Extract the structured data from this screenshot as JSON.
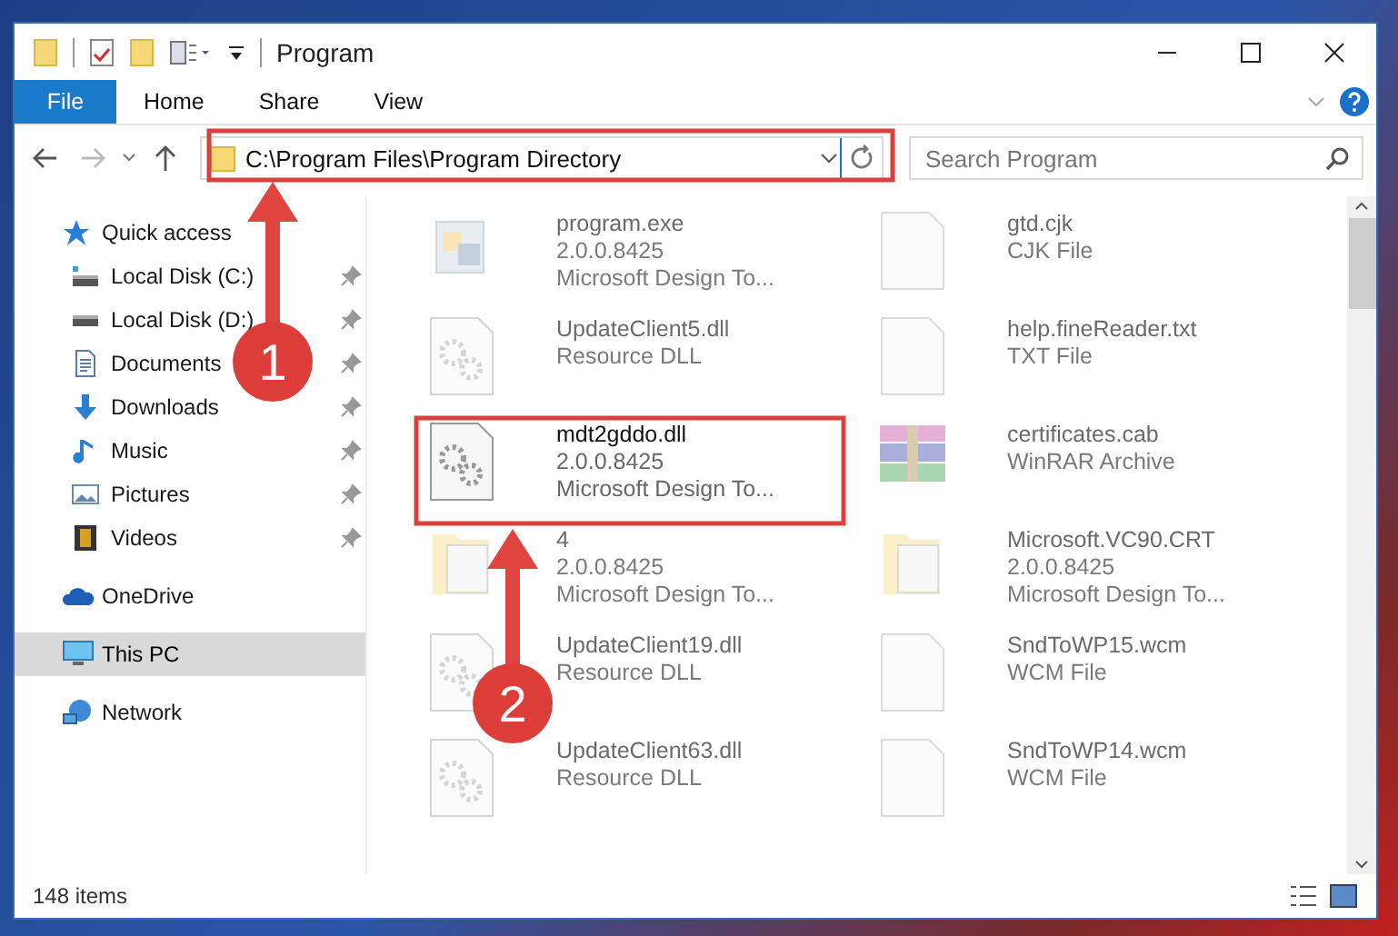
{
  "window": {
    "title": "Program"
  },
  "ribbon_tabs": [
    {
      "label": "File",
      "kind": "file"
    },
    {
      "label": "Home",
      "kind": "tab"
    },
    {
      "label": "Share",
      "kind": "tab"
    },
    {
      "label": "View",
      "kind": "tab"
    }
  ],
  "address_bar": {
    "path": "C:\\Program Files\\Program Directory"
  },
  "search": {
    "placeholder": "Search Program"
  },
  "nav": [
    {
      "label": "Quick access",
      "selected": false,
      "children": [
        {
          "label": "Local Disk (C:)",
          "pinned": true,
          "selected": false
        },
        {
          "label": "Local Disk (D:)",
          "pinned": true,
          "selected": false
        },
        {
          "label": "Documents",
          "pinned": true,
          "selected": false
        },
        {
          "label": "Downloads",
          "pinned": true,
          "selected": false
        },
        {
          "label": "Music",
          "pinned": true,
          "selected": false
        },
        {
          "label": "Pictures",
          "pinned": true,
          "selected": false
        },
        {
          "label": "Videos",
          "pinned": true,
          "selected": false
        }
      ]
    },
    {
      "label": "OneDrive",
      "selected": false
    },
    {
      "label": "This PC",
      "selected": true
    },
    {
      "label": "Network",
      "selected": false
    }
  ],
  "files": [
    {
      "name": "program.exe",
      "details": [
        "2.0.0.8425",
        "Microsoft Design To..."
      ],
      "kind": "exe",
      "faded": true
    },
    {
      "name": "gtd.cjk",
      "details": [
        "CJK File"
      ],
      "kind": "blank",
      "faded": true
    },
    {
      "name": "UpdateClient5.dll",
      "details": [
        "Resource DLL"
      ],
      "kind": "dll",
      "faded": true
    },
    {
      "name": "help.fineReader.txt",
      "details": [
        "TXT File"
      ],
      "kind": "blank",
      "faded": true
    },
    {
      "name": "mdt2gddo.dll",
      "details": [
        "2.0.0.8425",
        "Microsoft Design To..."
      ],
      "kind": "dll",
      "faded": false
    },
    {
      "name": "certificates.cab",
      "details": [
        "WinRAR Archive"
      ],
      "kind": "archive",
      "faded": true
    },
    {
      "name": "4",
      "details": [
        "2.0.0.8425",
        "Microsoft Design To..."
      ],
      "kind": "folder",
      "faded": true
    },
    {
      "name": "Microsoft.VC90.CRT",
      "details": [
        "2.0.0.8425",
        "Microsoft Design To..."
      ],
      "kind": "folder",
      "faded": true
    },
    {
      "name": "UpdateClient19.dll",
      "details": [
        "Resource DLL"
      ],
      "kind": "dll",
      "faded": true
    },
    {
      "name": "SndToWP15.wcm",
      "details": [
        "WCM File"
      ],
      "kind": "blank",
      "faded": true
    },
    {
      "name": "UpdateClient63.dll",
      "details": [
        "Resource DLL"
      ],
      "kind": "dll",
      "faded": true
    },
    {
      "name": "SndToWP14.wcm",
      "details": [
        "WCM File"
      ],
      "kind": "blank",
      "faded": true
    }
  ],
  "status_bar": {
    "count": "148 items"
  },
  "step_markers": [
    "1",
    "2"
  ]
}
